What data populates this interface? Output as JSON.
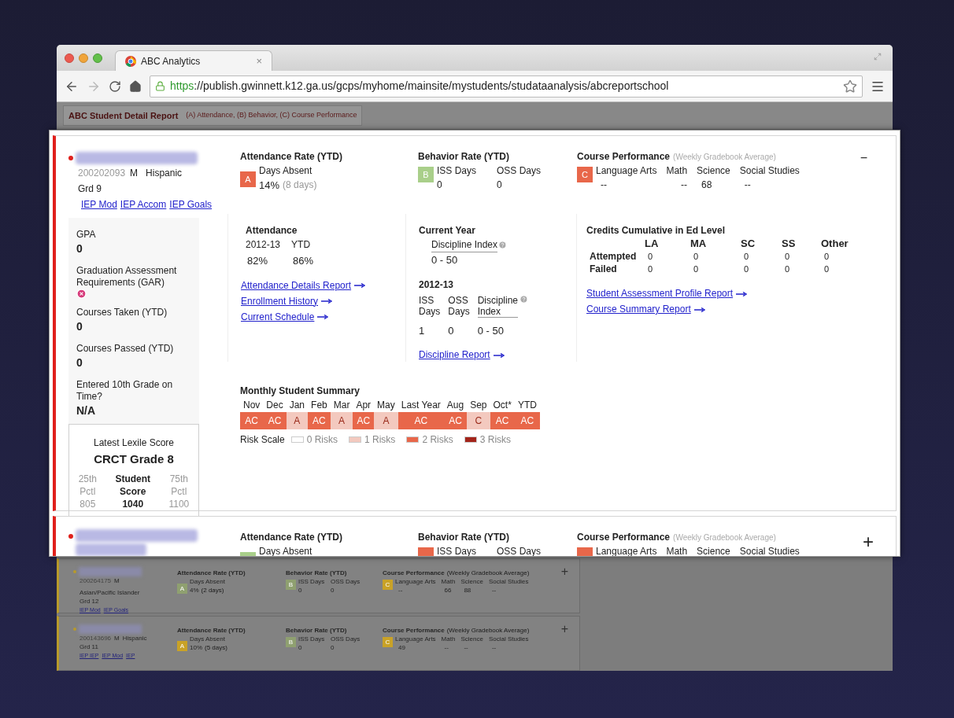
{
  "browser": {
    "tab_title": "ABC Analytics",
    "tab_close": "×",
    "url_scheme": "https",
    "url_rest": "://publish.gwinnett.k12.ga.us/gcps/myhome/mainsite/mystudents/studataanalysis/abcreportschool"
  },
  "report_header": {
    "title": "ABC Student Detail Report",
    "legend": "(A) Attendance, (B) Behavior, (C) Course Performance"
  },
  "expanded_student": {
    "id": "200202093",
    "gender": "M",
    "ethnicity": "Hispanic",
    "grade": "Grd 9",
    "links": [
      "IEP Mod",
      "IEP Accom",
      "IEP Goals"
    ],
    "toggle": "−",
    "stats": [
      {
        "kind": "text",
        "label": "GPA",
        "value": "0"
      },
      {
        "kind": "fail",
        "label": "Graduation Assessment Requirements (GAR)"
      },
      {
        "kind": "text",
        "label": "Courses Taken (YTD)",
        "value": "0"
      },
      {
        "kind": "text",
        "label": "Courses Passed (YTD)",
        "value": "0"
      },
      {
        "kind": "text",
        "label": "Entered 10th Grade on Time?",
        "value": "N/A"
      }
    ],
    "lexile": {
      "title": "Latest Lexile Score",
      "test": "CRCT Grade 8",
      "columns": [
        {
          "line1": "25th",
          "line2": "Pctl",
          "value": "805",
          "bold": false
        },
        {
          "line1": "Student",
          "line2": "Score",
          "value": "1040",
          "bold": true
        },
        {
          "line1": "75th",
          "line2": "Pctl",
          "value": "1100",
          "bold": false
        }
      ]
    },
    "attendance": {
      "title": "Attendance Rate (YTD)",
      "grade": "A",
      "color": "#e8674a",
      "label": "Days Absent",
      "value": "14%",
      "note": "(8 days)"
    },
    "attendance_detail": {
      "title": "Attendance",
      "columns": [
        {
          "head": "2012-13",
          "value": "82%"
        },
        {
          "head": "YTD",
          "value": "86%"
        }
      ],
      "links": [
        "Attendance Details Report",
        "Enrollment History",
        "Current Schedule"
      ]
    },
    "behavior": {
      "title": "Behavior Rate (YTD)",
      "grade": "B",
      "color": "#a9cf8a",
      "columns": [
        {
          "head": "ISS Days",
          "value": "0"
        },
        {
          "head": "OSS Days",
          "value": "0"
        }
      ]
    },
    "current_year": {
      "title": "Current Year",
      "index_label": "Discipline Index",
      "index_value": "0 - 50"
    },
    "prior_year": {
      "title": "2012-13",
      "columns": [
        {
          "head": "ISS Days",
          "value": "1",
          "help": false
        },
        {
          "head": "OSS Days",
          "value": "0",
          "help": false
        },
        {
          "head": "Discipline Index",
          "value": "0 - 50",
          "help": true
        }
      ],
      "link": "Discipline Report"
    },
    "course": {
      "title": "Course Performance",
      "note": "(Weekly Gradebook Average)",
      "grade": "C",
      "color": "#e8674a",
      "columns": [
        {
          "head": "Language Arts",
          "value": "--"
        },
        {
          "head": "Math",
          "value": "--"
        },
        {
          "head": "Science",
          "value": "68"
        },
        {
          "head": "Social Studies",
          "value": "--"
        }
      ]
    },
    "credits": {
      "title": "Credits Cumulative in Ed Level",
      "columns": [
        "LA",
        "MA",
        "SC",
        "SS",
        "Other"
      ],
      "rows": [
        {
          "label": "Attempted",
          "values": [
            "0",
            "0",
            "0",
            "0",
            "0"
          ]
        },
        {
          "label": "Failed",
          "values": [
            "0",
            "0",
            "0",
            "0",
            "0"
          ]
        }
      ],
      "links": [
        "Student Assessment Profile Report",
        "Course Summary Report"
      ]
    },
    "monthly": {
      "title": "Monthly Student Summary",
      "months": [
        {
          "label": "Nov",
          "code": "AC",
          "color": "#e8674a"
        },
        {
          "label": "Dec",
          "code": "AC",
          "color": "#e8674a"
        },
        {
          "label": "Jan",
          "code": "A",
          "color": "#f3c9bf"
        },
        {
          "label": "Feb",
          "code": "AC",
          "color": "#e8674a"
        },
        {
          "label": "Mar",
          "code": "A",
          "color": "#f3c9bf"
        },
        {
          "label": "Apr",
          "code": "AC",
          "color": "#e8674a"
        },
        {
          "label": "May",
          "code": "A",
          "color": "#f3c9bf"
        },
        {
          "label": "Last Year",
          "code": "AC",
          "color": "#e8674a"
        },
        {
          "label": "Aug",
          "code": "AC",
          "color": "#e8674a"
        },
        {
          "label": "Sep",
          "code": "C",
          "color": "#f3c9bf"
        },
        {
          "label": "Oct*",
          "code": "AC",
          "color": "#e8674a"
        },
        {
          "label": "YTD",
          "code": "AC",
          "color": "#e8674a"
        }
      ],
      "scale_label": "Risk Scale",
      "scale": [
        {
          "label": "0 Risks",
          "color": "#ffffff"
        },
        {
          "label": "1 Risks",
          "color": "#f3c9bf"
        },
        {
          "label": "2 Risks",
          "color": "#e8674a"
        },
        {
          "label": "3 Risks",
          "color": "#a3241a"
        }
      ]
    }
  },
  "partial_student": {
    "toggle": "+",
    "attendance": {
      "title": "Attendance Rate (YTD)",
      "label": "Days Absent",
      "color": "#a9cf8a"
    },
    "behavior": {
      "title": "Behavior Rate (YTD)",
      "heads": [
        "ISS Days",
        "OSS Days"
      ],
      "color": "#e8674a"
    },
    "course": {
      "title": "Course Performance",
      "note": "(Weekly Gradebook Average)",
      "heads": [
        "Language Arts",
        "Math",
        "Science",
        "Social Studies"
      ],
      "color": "#e8674a"
    }
  },
  "collapsed_students": [
    {
      "id": "200264175",
      "gender": "M",
      "ethnicity": "Asian/Pacific Islander",
      "grade": "Grd 12",
      "links": [
        "IEP Mod",
        "IEP Goals"
      ],
      "toggle": "+",
      "attendance": {
        "title": "Attendance Rate (YTD)",
        "label": "Days Absent",
        "grade": "A",
        "color": "#8fa070",
        "value": "4%",
        "note": "(2 days)"
      },
      "behavior": {
        "title": "Behavior Rate (YTD)",
        "grade": "B",
        "color": "#8fa070",
        "columns": [
          {
            "head": "ISS Days",
            "value": "0"
          },
          {
            "head": "OSS Days",
            "value": "0"
          }
        ]
      },
      "course": {
        "title": "Course Performance",
        "note": "(Weekly Gradebook Average)",
        "grade": "C",
        "color": "#c9a227",
        "columns": [
          {
            "head": "Language Arts",
            "value": "--"
          },
          {
            "head": "Math",
            "value": "66"
          },
          {
            "head": "Science",
            "value": "88"
          },
          {
            "head": "Social Studies",
            "value": "--"
          }
        ]
      }
    },
    {
      "id": "200143696",
      "gender": "M",
      "ethnicity": "Hispanic",
      "grade": "Grd 11",
      "links": [
        "IEP IEP",
        "IEP Mod",
        "IEP"
      ],
      "toggle": "+",
      "attendance": {
        "title": "Attendance Rate (YTD)",
        "label": "Days Absent",
        "grade": "A",
        "color": "#c9a227",
        "value": "10%",
        "note": "(5 days)"
      },
      "behavior": {
        "title": "Behavior Rate (YTD)",
        "grade": "B",
        "color": "#8fa070",
        "columns": [
          {
            "head": "ISS Days",
            "value": "0"
          },
          {
            "head": "OSS Days",
            "value": "0"
          }
        ]
      },
      "course": {
        "title": "Course Performance",
        "note": "(Weekly Gradebook Average)",
        "grade": "C",
        "color": "#c9a227",
        "columns": [
          {
            "head": "Language Arts",
            "value": "49"
          },
          {
            "head": "Math",
            "value": "--"
          },
          {
            "head": "Science",
            "value": "--"
          },
          {
            "head": "Social Studies",
            "value": "--"
          }
        ]
      }
    }
  ]
}
